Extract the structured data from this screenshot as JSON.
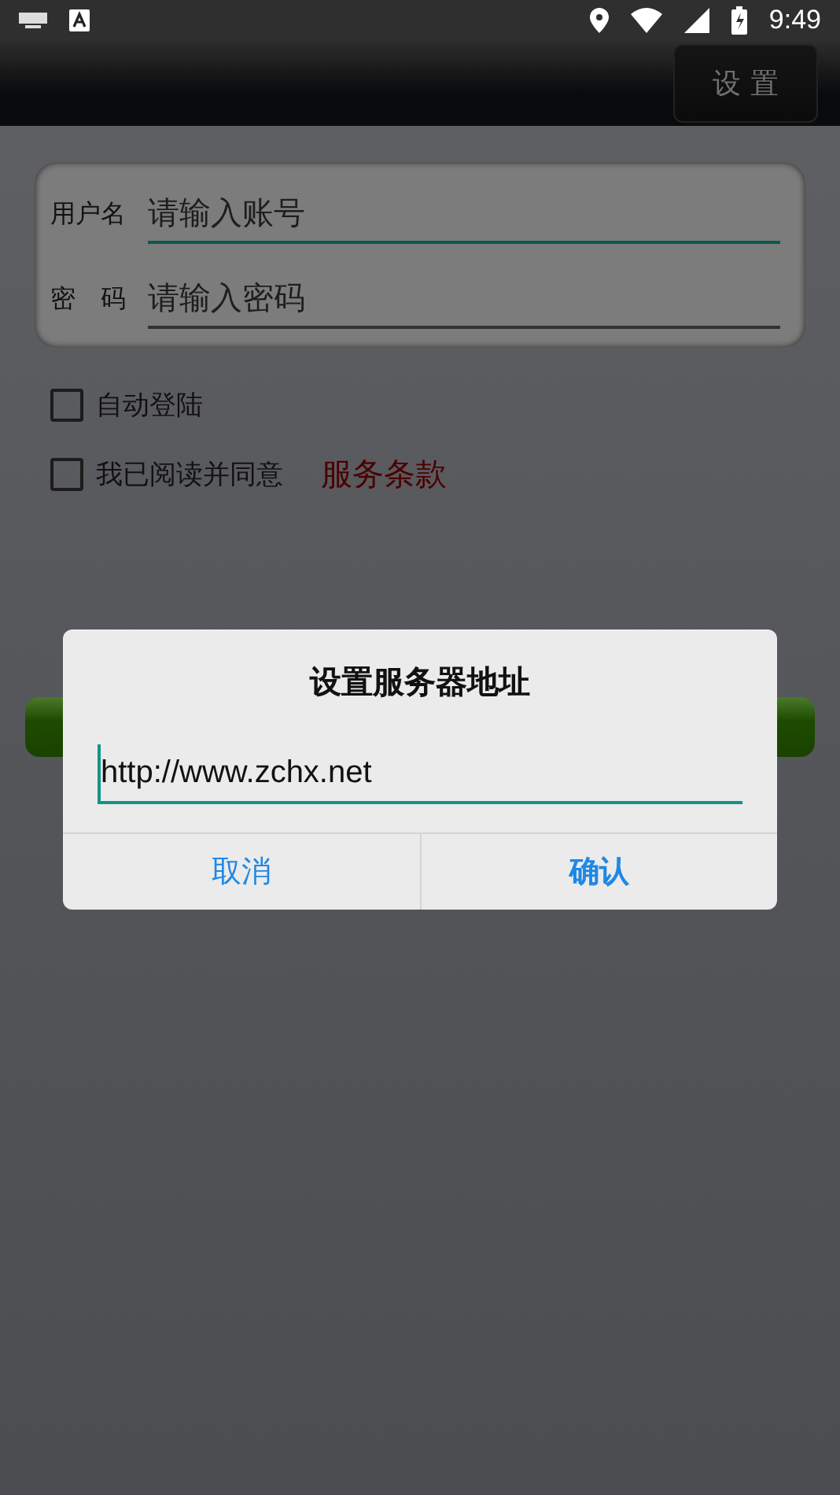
{
  "status_bar": {
    "time": "9:49"
  },
  "toolbar": {
    "settings_button": "设 置"
  },
  "login_form": {
    "fields": [
      {
        "label": "用户名",
        "placeholder": "请输入账号",
        "focused": true
      },
      {
        "label": "密　码",
        "placeholder": "请输入密码",
        "focused": false
      }
    ]
  },
  "options": [
    {
      "label": "自动登陆",
      "checked": false
    },
    {
      "label": "我已阅读并同意",
      "checked": false,
      "link": "服务条款"
    }
  ],
  "dialog": {
    "title": "设置服务器地址",
    "url": "http://www.zchx.net",
    "buttons": [
      {
        "label": "取消",
        "bold": false
      },
      {
        "label": "确认",
        "bold": true
      }
    ]
  }
}
